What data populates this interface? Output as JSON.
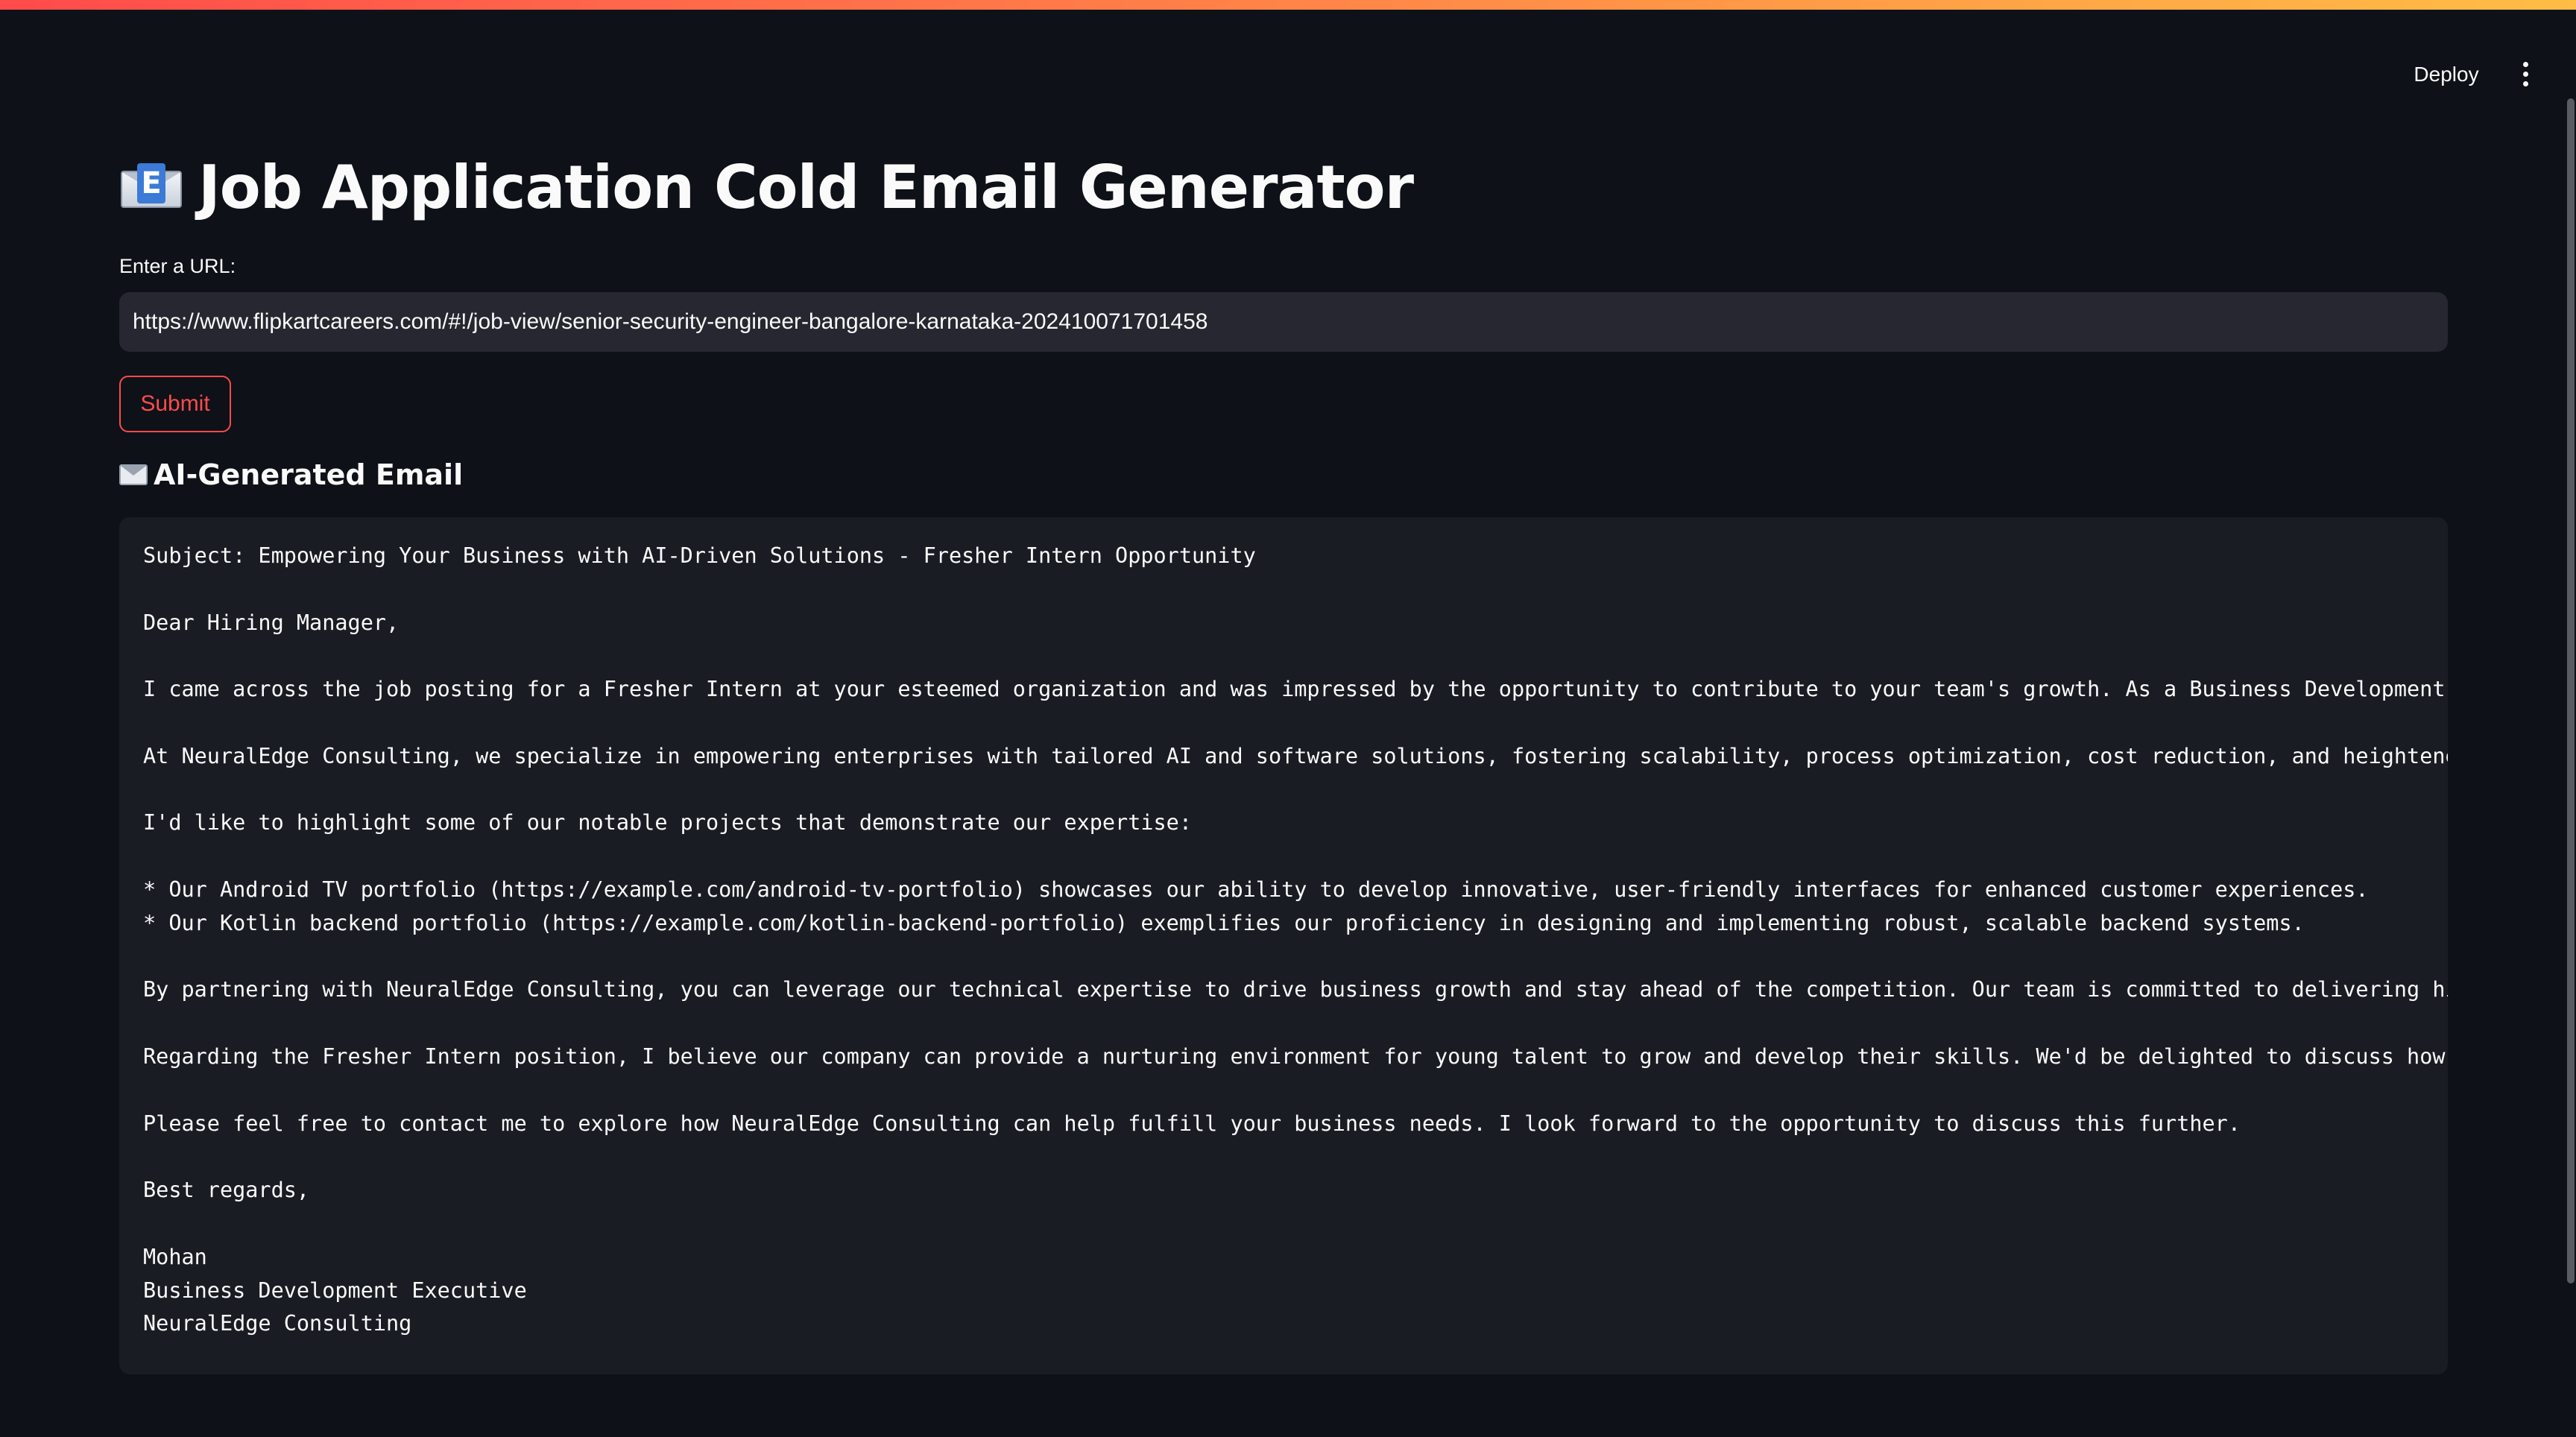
{
  "header": {
    "deploy_label": "Deploy",
    "menu_icon": "kebab-menu-icon"
  },
  "main": {
    "title_icon": "e-mail-icon",
    "title": "Job Application Cold Email Generator",
    "url_label": "Enter a URL:",
    "url_value": "https://www.flipkartcareers.com/#!/job-view/senior-security-engineer-bangalore-karnataka-202410071701458",
    "submit_label": "Submit",
    "subheader_icon": "envelope-icon",
    "subheader": "AI-Generated Email",
    "email_lines": [
      "Subject: Empowering Your Business with AI-Driven Solutions - Fresher Intern Opportunity",
      "",
      "Dear Hiring Manager,",
      "",
      "I came across the job posting for a Fresher Intern at your esteemed organization and was impressed by the opportunity to contribute to your team's growth. As a Business Development Exe",
      "",
      "At NeuralEdge Consulting, we specialize in empowering enterprises with tailored AI and software solutions, fostering scalability, process optimization, cost reduction, and heightened o",
      "",
      "I'd like to highlight some of our notable projects that demonstrate our expertise:",
      "",
      "* Our Android TV portfolio (https://example.com/android-tv-portfolio) showcases our ability to develop innovative, user-friendly interfaces for enhanced customer experiences.",
      "* Our Kotlin backend portfolio (https://example.com/kotlin-backend-portfolio) exemplifies our proficiency in designing and implementing robust, scalable backend systems.",
      "",
      "By partnering with NeuralEdge Consulting, you can leverage our technical expertise to drive business growth and stay ahead of the competition. Our team is committed to delivering high-",
      "",
      "Regarding the Fresher Intern position, I believe our company can provide a nurturing environment for young talent to grow and develop their skills. We'd be delighted to discuss how our",
      "",
      "Please feel free to contact me to explore how NeuralEdge Consulting can help fulfill your business needs. I look forward to the opportunity to discuss this further.",
      "",
      "Best regards,",
      "",
      "Mohan",
      "Business Development Executive",
      "NeuralEdge Consulting"
    ]
  },
  "colors": {
    "background": "#0e1117",
    "input_background": "#262730",
    "code_background": "#1a1c24",
    "accent": "#ff4b4b",
    "text": "#fafafa"
  }
}
